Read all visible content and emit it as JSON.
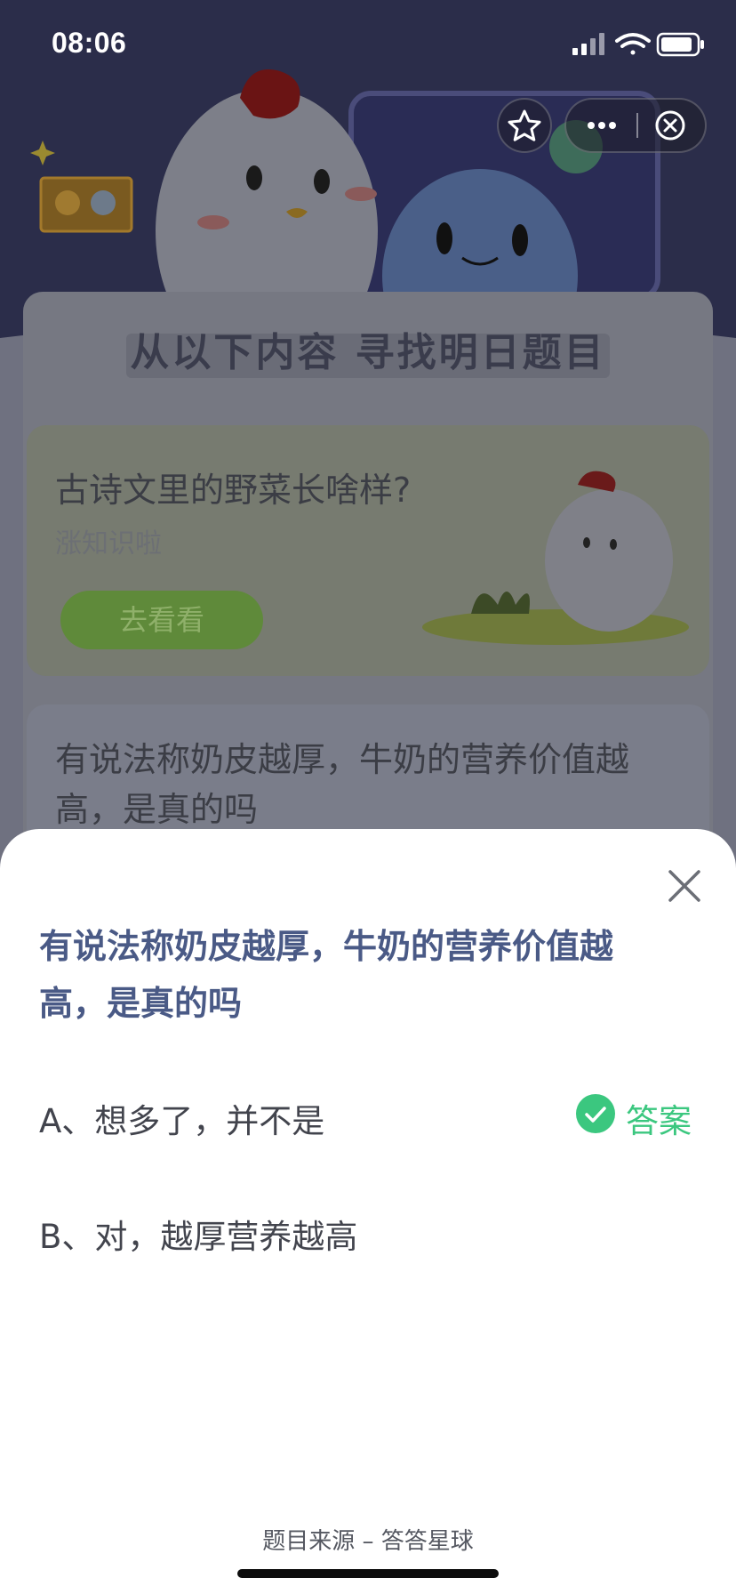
{
  "status_bar": {
    "time": "08:06"
  },
  "background": {
    "banner_title": "从以下内容 寻找明日题目",
    "card1": {
      "title": "古诗文里的野菜长啥样?",
      "subtitle": "涨知识啦",
      "button": "去看看"
    },
    "card2": {
      "title": "有说法称奶皮越厚，牛奶的营养价值越高，是真的吗"
    }
  },
  "icons": {
    "favorite": "star-icon",
    "more": "more-dots-icon",
    "close_program": "close-circle-icon",
    "sheet_close": "close-x-icon",
    "check": "check-circle-icon"
  },
  "sheet": {
    "question": "有说法称奶皮越厚，牛奶的营养价值越高，是真的吗",
    "options": [
      {
        "label": "A、想多了，并不是",
        "is_answer": true
      },
      {
        "label": "B、对，越厚营养越高",
        "is_answer": false
      }
    ],
    "answer_label": "答案",
    "source": "题目来源 – 答答星球"
  },
  "colors": {
    "accent_green": "#3bc77f",
    "question_color": "#4a5a86",
    "header_bg": "#3b3d5e"
  }
}
